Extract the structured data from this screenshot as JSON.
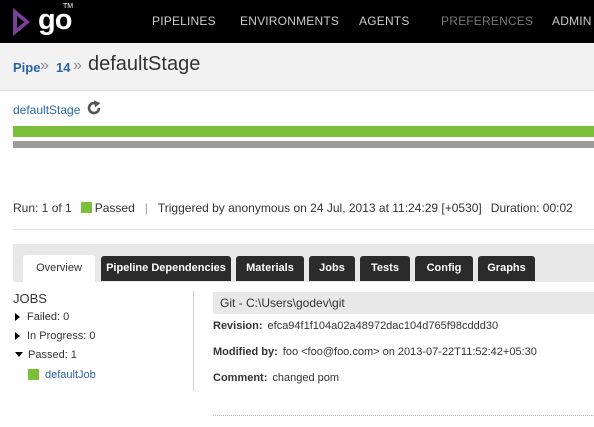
{
  "nav": {
    "brand": "go",
    "brand_mark": "TM",
    "items": [
      {
        "label": "PIPELINES"
      },
      {
        "label": "ENVIRONMENTS"
      },
      {
        "label": "AGENTS"
      },
      {
        "label": "PREFERENCES"
      },
      {
        "label": "ADMIN"
      }
    ]
  },
  "breadcrumb": {
    "pipeline": "Pipe",
    "counter": "14",
    "separator": "»",
    "title": "defaultStage"
  },
  "stage": {
    "name": "defaultStage",
    "icon": "refresh-icon"
  },
  "run": {
    "run_text": "Run: 1 of 1",
    "status": "Passed",
    "separator": "|",
    "triggered": "Triggered by anonymous on 24 Jul, 2013 at 11:24:29 [+0530]",
    "duration": "Duration: 00:02"
  },
  "tabs": [
    {
      "label": "Overview",
      "active": true
    },
    {
      "label": "Pipeline Dependencies"
    },
    {
      "label": "Materials"
    },
    {
      "label": "Jobs"
    },
    {
      "label": "Tests"
    },
    {
      "label": "Config"
    },
    {
      "label": "Graphs"
    }
  ],
  "jobs": {
    "title": "JOBS",
    "failed": "Failed: 0",
    "in_progress": "In Progress: 0",
    "passed": "Passed: 1",
    "passed_jobs": [
      {
        "name": "defaultJob"
      }
    ]
  },
  "material": {
    "header": "Git - C:\\Users\\godev\\git",
    "revision_label": "Revision:",
    "revision": "efca94f1f104a02a48972dac104d765f98cddd30",
    "modified_label": "Modified by:",
    "modified": "foo <foo@foo.com> on 2013-07-22T11:52:42+05:30",
    "comment_label": "Comment:",
    "comment": "changed pom"
  },
  "colors": {
    "passed": "#7cbf3b",
    "link": "#2a64a8",
    "nav_bg": "#000000"
  }
}
